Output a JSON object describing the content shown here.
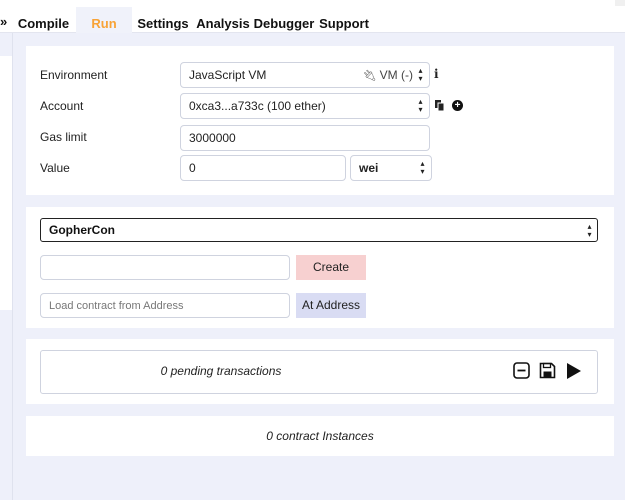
{
  "tabs": [
    {
      "label": "Compile"
    },
    {
      "label": "Run"
    },
    {
      "label": "Settings"
    },
    {
      "label": "Analysis"
    },
    {
      "label": "Debugger"
    },
    {
      "label": "Support"
    }
  ],
  "active_tab": "Run",
  "accent_color": "#f8a336",
  "collapse_glyph": "»",
  "environment": {
    "label": "Environment",
    "value": "JavaScript VM",
    "vm_tag": "VM (-)",
    "info_glyph": "i"
  },
  "account": {
    "label": "Account",
    "value": "0xca3...a733c (100 ether)"
  },
  "gas_limit": {
    "label": "Gas limit",
    "value": "3000000"
  },
  "value_field": {
    "label": "Value",
    "value": "0",
    "unit": "wei"
  },
  "contract": {
    "selected": "GopherCon",
    "create_label": "Create",
    "create_args_value": "",
    "address_placeholder": "Load contract from Address",
    "at_address_label": "At Address"
  },
  "transactions": {
    "pending_text": "0 pending transactions"
  },
  "instances": {
    "text": "0 contract Instances"
  }
}
